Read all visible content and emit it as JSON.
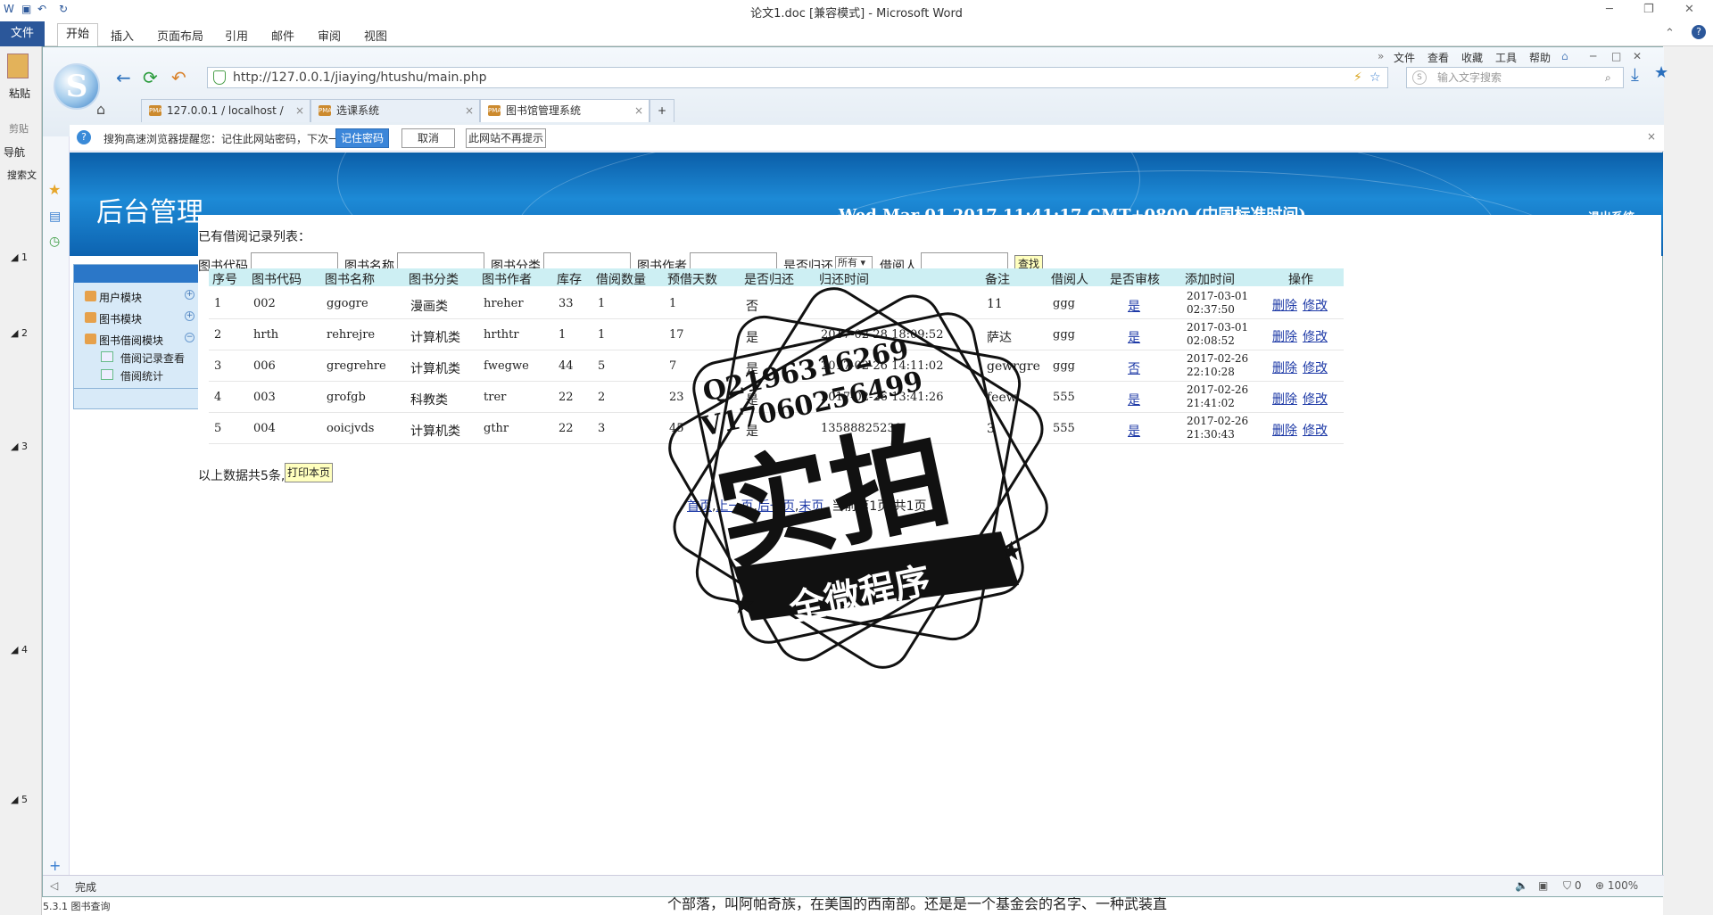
{
  "word": {
    "title": "论文1.doc [兼容模式] - Microsoft Word",
    "tabs": [
      "文件",
      "开始",
      "插入",
      "页面布局",
      "引用",
      "邮件",
      "审阅",
      "视图"
    ],
    "paste_label": "粘贴",
    "clip_label": "剪贴",
    "nav_label": "导航",
    "nav_search": "搜索文",
    "outline_nums": [
      "1",
      "2",
      "3",
      "4",
      "5"
    ],
    "outline_bottom": "5.3.1 图书查询",
    "doc_text": "个部落，叫阿帕奇族，在美国的西南部。还是是一个基金会的名字、一种武装直"
  },
  "browser": {
    "menu": [
      "文件",
      "查看",
      "收藏",
      "工具",
      "帮助"
    ],
    "url": "http://127.0.0.1/jiaying/htushu/main.php",
    "search_placeholder": "输入文字搜索",
    "tabs": [
      {
        "label": "127.0.0.1 / localhost /"
      },
      {
        "label": "选课系统"
      },
      {
        "label": "图书馆管理系统"
      }
    ],
    "infobar": {
      "message": "搜狗高速浏览器提醒您：记住此网站密码，下次一键登录！",
      "btn_remember": "记住密码",
      "btn_cancel": "取消",
      "btn_never": "此网站不再提示"
    },
    "status": {
      "text": "完成",
      "zoom": "100%",
      "count": "0"
    }
  },
  "page": {
    "banner_title": "后台管理",
    "banner_time": "Wed Mar 01 2017 11:41:17 GMT+0800 (中国标准时间)",
    "logout": "退出系统",
    "sidebar": {
      "modules": [
        "用户模块",
        "图书模块",
        "图书借阅模块"
      ],
      "subitems": [
        "借阅记录查看",
        "借阅统计"
      ]
    },
    "list_title": "已有借阅记录列表：",
    "filters": {
      "code": "图书代码",
      "name": "图书名称",
      "category": "图书分类",
      "author": "图书作者",
      "returned": "是否归还",
      "returned_value": "所有",
      "borrower": "借阅人",
      "find": "查找"
    },
    "headers": [
      "序号",
      "图书代码",
      "图书名称",
      "图书分类",
      "图书作者",
      "库存",
      "借阅数量",
      "预借天数",
      "是否归还",
      "归还时间",
      "备注",
      "借阅人",
      "是否审核",
      "添加时间",
      "操作"
    ],
    "rows": [
      {
        "no": "1",
        "code": "002",
        "name": "ggogre",
        "cat": "漫画类",
        "author": "hreher",
        "stock": "33",
        "qty": "1",
        "days": "1",
        "ret": "否",
        "rtime": "",
        "note": "11",
        "user": "ggg",
        "audit": "是",
        "added1": "2017-03-01",
        "added2": "02:37:50"
      },
      {
        "no": "2",
        "code": "hrth",
        "name": "rehrejre",
        "cat": "计算机类",
        "author": "hrthtr",
        "stock": "1",
        "qty": "1",
        "days": "17",
        "ret": "是",
        "rtime": "2017-02-28 18:09:52",
        "note": "萨达",
        "user": "ggg",
        "audit": "是",
        "added1": "2017-03-01",
        "added2": "02:08:52"
      },
      {
        "no": "3",
        "code": "006",
        "name": "gregrehre",
        "cat": "计算机类",
        "author": "fwegwe",
        "stock": "44",
        "qty": "5",
        "days": "7",
        "ret": "是",
        "rtime": "2017-02-26 14:11:02",
        "note": "gewrgre",
        "user": "ggg",
        "audit": "否",
        "added1": "2017-02-26",
        "added2": "22:10:28"
      },
      {
        "no": "4",
        "code": "003",
        "name": "grofgb",
        "cat": "科教类",
        "author": "trer",
        "stock": "22",
        "qty": "2",
        "days": "23",
        "ret": "是",
        "rtime": "2017-02-26 13:41:26",
        "note": "feew",
        "user": "555",
        "audit": "是",
        "added1": "2017-02-26",
        "added2": "21:41:02"
      },
      {
        "no": "5",
        "code": "004",
        "name": "ooicjvds",
        "cat": "计算机类",
        "author": "gthr",
        "stock": "22",
        "qty": "3",
        "days": "45",
        "ret": "是",
        "rtime": "13588825239",
        "note": "3",
        "user": "555",
        "audit": "是",
        "added1": "2017-02-26",
        "added2": "21:30:43"
      }
    ],
    "op_delete": "删除",
    "op_edit": "修改",
    "total": "以上数据共5条,",
    "print": "打印本页",
    "pager": {
      "first": "首页",
      "prev": "上一页",
      "next": "后一页",
      "last": "末页",
      "info": "当前第1页,共1页"
    }
  },
  "stamp": {
    "line1": "Q2196316269",
    "line2": "V17060256499",
    "big": "实拍",
    "ribbon": "全微程序"
  }
}
